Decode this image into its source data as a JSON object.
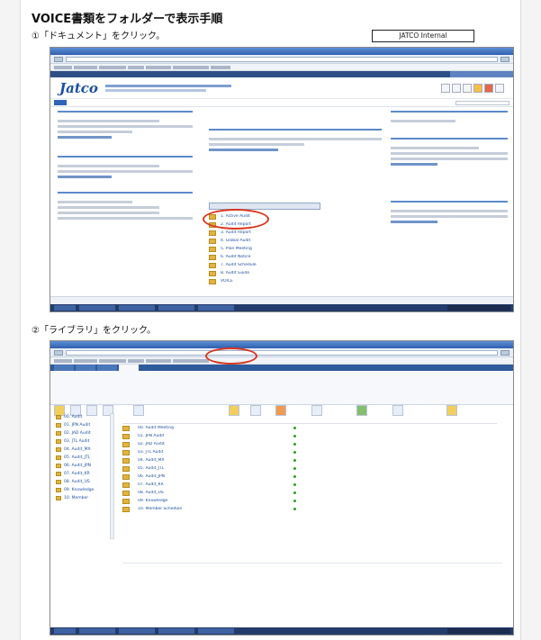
{
  "document": {
    "title": "VOICE書類をフォルダーで表示手順",
    "step1": "①「ドキュメント」をクリック。",
    "step2": "②「ライブラリ」をクリック。",
    "classification": "JATCO Internal"
  },
  "shot1": {
    "logo": "Jatco",
    "library_items": [
      {
        "name": "1. Active Audit",
        "date": ""
      },
      {
        "name": "2. Audit Report",
        "date": ""
      },
      {
        "name": "3. Audit Report",
        "date": ""
      },
      {
        "name": "4. Global Audit",
        "date": ""
      },
      {
        "name": "5. Plan Meeting",
        "date": ""
      },
      {
        "name": "6. Audit Notice",
        "date": ""
      },
      {
        "name": "7. Audit Schedule",
        "date": ""
      },
      {
        "name": "8. Audit Guide",
        "date": ""
      },
      {
        "name": "VOICE",
        "date": ""
      }
    ]
  },
  "shot2": {
    "library_rows": [
      {
        "name": "00. Audit Meeting",
        "modified": "",
        "by": ""
      },
      {
        "name": "01. JPN Audit",
        "modified": "",
        "by": ""
      },
      {
        "name": "02. JAD Audit",
        "modified": "",
        "by": ""
      },
      {
        "name": "03. JTL Audit",
        "modified": "",
        "by": ""
      },
      {
        "name": "04. Audit_MX",
        "modified": "",
        "by": ""
      },
      {
        "name": "05. Audit_JTL",
        "modified": "",
        "by": ""
      },
      {
        "name": "06. Audit_JPN",
        "modified": "",
        "by": ""
      },
      {
        "name": "07. Audit_KR",
        "modified": "",
        "by": ""
      },
      {
        "name": "08. Audit_US",
        "modified": "",
        "by": ""
      },
      {
        "name": "09. Knowledge",
        "modified": "",
        "by": ""
      },
      {
        "name": "10. Member Schedule",
        "modified": "",
        "by": ""
      }
    ],
    "nav_items": [
      "00. Audit",
      "01. JPN Audit",
      "02. JAD Audit",
      "03. JTL Audit",
      "04. Audit_MX",
      "05. Audit_JTL",
      "06. Audit_JPN",
      "07. Audit_KR",
      "08. Audit_US",
      "09. Knowledge",
      "10. Member"
    ]
  },
  "colors": {
    "accent": "#1b4fa2",
    "highlight_circle": "#d9361f",
    "folder": "#e3b341"
  }
}
